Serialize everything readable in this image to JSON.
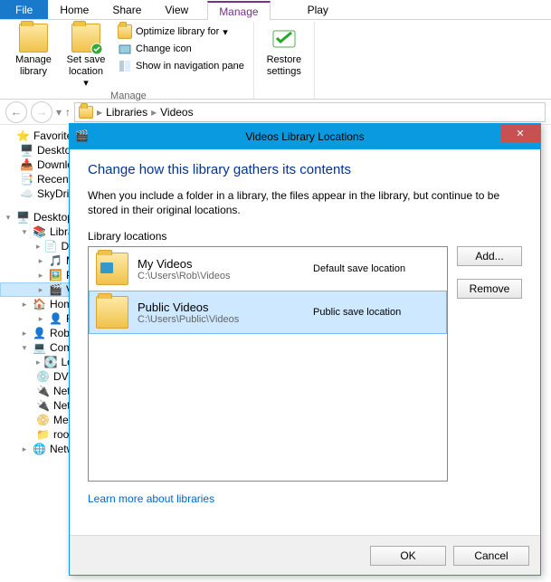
{
  "tabs": {
    "file": "File",
    "home": "Home",
    "share": "Share",
    "view": "View",
    "manage": "Manage",
    "play": "Play"
  },
  "ribbon": {
    "manage_library": "Manage library",
    "set_save": "Set save location",
    "optimize": "Optimize library for",
    "change_icon": "Change icon",
    "show_nav": "Show in navigation pane",
    "group_manage": "Manage",
    "restore": "Restore settings"
  },
  "breadcrumb": {
    "a": "Libraries",
    "b": "Videos"
  },
  "tree": {
    "favorites": "Favorites",
    "desktop": "Desktop",
    "downloads": "Downloads",
    "recent": "Recent places",
    "skydrive": "SkyDrive",
    "desktop2": "Desktop",
    "libraries": "Libraries",
    "documents": "Documents",
    "music": "Music",
    "pictures": "Pictures",
    "videos": "Videos",
    "homegroup": "Homegroup",
    "rob1": "Rob",
    "rob2": "Rob",
    "computer": "Computer",
    "local": "Local Disk (C:)",
    "dvd": "DVD Drive (D:)",
    "net1": "Network Location",
    "net2": "Network Location",
    "media": "Media",
    "root": "root",
    "network": "Network"
  },
  "dialog": {
    "title": "Videos Library Locations",
    "heading": "Change how this library gathers its contents",
    "desc": "When you include a folder in a library, the files appear in the library, but continue to be stored in their original locations.",
    "subhead": "Library locations",
    "add": "Add...",
    "remove": "Remove",
    "items": [
      {
        "name": "My Videos",
        "path": "C:\\Users\\Rob\\Videos",
        "tag": "Default save location"
      },
      {
        "name": "Public Videos",
        "path": "C:\\Users\\Public\\Videos",
        "tag": "Public save location"
      }
    ],
    "learn": "Learn more about libraries",
    "ok": "OK",
    "cancel": "Cancel"
  }
}
